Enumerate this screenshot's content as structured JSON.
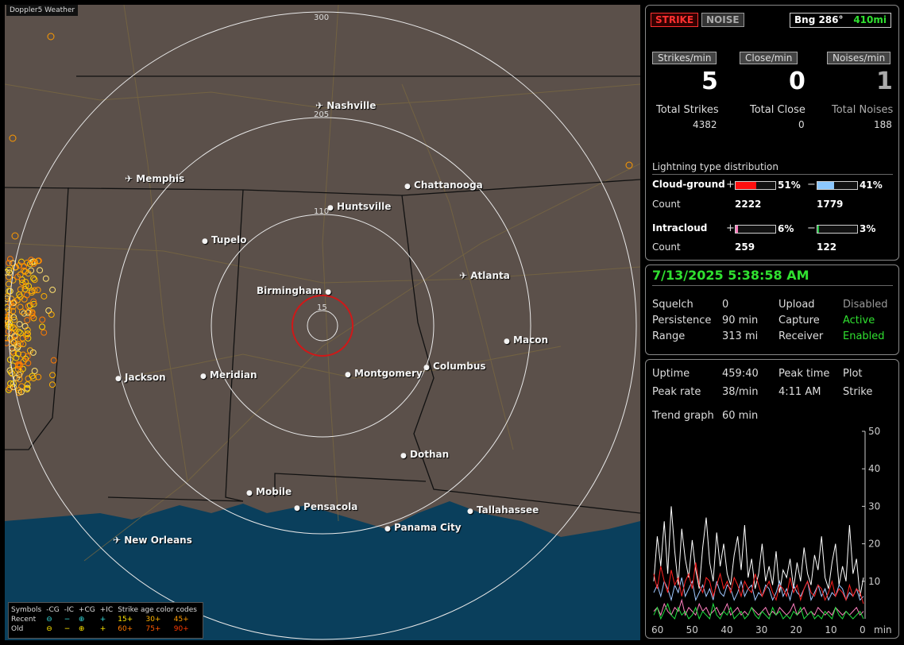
{
  "map": {
    "title": "Doppler5 Weather",
    "ring_labels": [
      "300",
      "205",
      "110",
      "15"
    ],
    "cities": [
      {
        "name": "Nashville",
        "icon": "airport-icon"
      },
      {
        "name": "Memphis",
        "icon": "airport-icon"
      },
      {
        "name": "Chattanooga",
        "icon": "city-dot-icon"
      },
      {
        "name": "Huntsville",
        "icon": "city-dot-icon"
      },
      {
        "name": "Tupelo",
        "icon": "city-dot-icon"
      },
      {
        "name": "Atlanta",
        "icon": "airport-icon"
      },
      {
        "name": "Birmingham",
        "icon": "city-dot-icon"
      },
      {
        "name": "Macon",
        "icon": "city-dot-icon"
      },
      {
        "name": "Jackson",
        "icon": "city-dot-icon"
      },
      {
        "name": "Meridian",
        "icon": "city-dot-icon"
      },
      {
        "name": "Montgomery",
        "icon": "city-dot-icon"
      },
      {
        "name": "Columbus",
        "icon": "city-dot-icon"
      },
      {
        "name": "Dothan",
        "icon": "city-dot-icon"
      },
      {
        "name": "Mobile",
        "icon": "city-dot-icon"
      },
      {
        "name": "Pensacola",
        "icon": "city-dot-icon"
      },
      {
        "name": "Tallahassee",
        "icon": "city-dot-icon"
      },
      {
        "name": "Panama City",
        "icon": "city-dot-icon"
      },
      {
        "name": "New Orleans",
        "icon": "airport-icon"
      }
    ],
    "legend": {
      "symbols": "Symbols",
      "cg_neg": "-CG",
      "ic_neg": "-IC",
      "cg_pos": "+CG",
      "ic_pos": "+IC",
      "age_title": "Strike age color codes",
      "recent": "Recent",
      "old": "Old",
      "recent_ages": [
        "15+",
        "30+",
        "45+"
      ],
      "old_ages": [
        "60+",
        "75+",
        "90+"
      ]
    }
  },
  "status": {
    "strike_button": "STRIKE",
    "noise_button": "NOISE",
    "bearing_label": "Bng 286°",
    "bearing_distance": "410mi",
    "strikes_per_min_label": "Strikes/min",
    "close_per_min_label": "Close/min",
    "noises_per_min_label": "Noises/min",
    "strikes_per_min": "5",
    "close_per_min": "0",
    "noises_per_min": "1",
    "total_strikes_label": "Total Strikes",
    "total_close_label": "Total Close",
    "total_noises_label": "Total Noises",
    "total_strikes": "4382",
    "total_close": "0",
    "total_noises": "188",
    "distribution_title": "Lightning type distribution",
    "cg_label": "Cloud-ground",
    "cg_pos_pct": "51%",
    "cg_neg_pct": "41%",
    "cg_pos_frac": 0.51,
    "cg_neg_frac": 0.41,
    "count_label": "Count",
    "cg_pos_count": "2222",
    "cg_neg_count": "1779",
    "ic_label": "Intracloud",
    "ic_pos_pct": "6%",
    "ic_neg_pct": "3%",
    "ic_pos_frac": 0.06,
    "ic_neg_frac": 0.03,
    "ic_pos_count": "259",
    "ic_neg_count": "122",
    "plus": "+",
    "minus": "−"
  },
  "settings": {
    "datetime": "7/13/2025 5:38:58 AM",
    "squelch_label": "Squelch",
    "squelch": "0",
    "persistence_label": "Persistence",
    "persistence": "90 min",
    "range_label": "Range",
    "range": "313 mi",
    "upload_label": "Upload",
    "upload": "Disabled",
    "capture_label": "Capture",
    "capture": "Active",
    "receiver_label": "Receiver",
    "receiver": "Enabled"
  },
  "trend": {
    "uptime_label": "Uptime",
    "uptime": "459:40",
    "peak_time_label": "Peak time",
    "plot_label": "Plot",
    "peak_rate_label": "Peak rate",
    "peak_rate": "38/min",
    "peak_time": "4:11 AM",
    "plot": "Strike",
    "trend_label": "Trend graph",
    "trend_window": "60 min",
    "y_ticks": [
      "50",
      "40",
      "30",
      "20",
      "10"
    ],
    "x_ticks": [
      "60",
      "50",
      "40",
      "30",
      "20",
      "10",
      "0"
    ],
    "x_unit": "min"
  },
  "chart_data": {
    "type": "line",
    "xlabel": "min",
    "ylim": [
      0,
      50
    ],
    "xlim": [
      60,
      0
    ],
    "series": [
      {
        "color": "#ffffff",
        "values": [
          10,
          22,
          14,
          26,
          12,
          30,
          18,
          9,
          24,
          16,
          11,
          21,
          13,
          8,
          19,
          27,
          15,
          10,
          23,
          14,
          20,
          12,
          9,
          17,
          22,
          13,
          25,
          11,
          16,
          8,
          12,
          20,
          10,
          14,
          9,
          18,
          7,
          13,
          11,
          16,
          8,
          15,
          10,
          19,
          12,
          9,
          17,
          13,
          22,
          11,
          8,
          15,
          20,
          9,
          14,
          10,
          25,
          12,
          16,
          6,
          11
        ]
      },
      {
        "color": "#a0c8ff",
        "values": [
          7,
          9,
          6,
          10,
          8,
          5,
          9,
          7,
          11,
          6,
          8,
          10,
          5,
          7,
          9,
          6,
          8,
          5,
          10,
          7,
          6,
          9,
          8,
          5,
          7,
          10,
          6,
          8,
          9,
          5,
          7,
          6,
          9,
          8,
          5,
          7,
          10,
          6,
          8,
          5,
          9,
          7,
          6,
          8,
          10,
          5,
          7,
          9,
          6,
          8,
          5,
          7,
          6,
          9,
          8,
          5,
          7,
          6,
          8,
          5,
          6
        ]
      },
      {
        "color": "#ff2020",
        "values": [
          12,
          8,
          14,
          10,
          7,
          13,
          9,
          11,
          6,
          10,
          12,
          8,
          15,
          9,
          7,
          11,
          10,
          6,
          9,
          12,
          8,
          10,
          7,
          11,
          9,
          6,
          10,
          8,
          7,
          12,
          9,
          6,
          8,
          10,
          7,
          5,
          9,
          8,
          6,
          11,
          7,
          9,
          5,
          8,
          10,
          7,
          6,
          9,
          8,
          5,
          7,
          10,
          6,
          8,
          7,
          5,
          9,
          6,
          8,
          7,
          4
        ]
      },
      {
        "color": "#ff80c0",
        "values": [
          2,
          3,
          1,
          4,
          2,
          1,
          3,
          2,
          5,
          1,
          3,
          2,
          1,
          4,
          2,
          3,
          1,
          2,
          3,
          1,
          2,
          4,
          1,
          2,
          3,
          1,
          2,
          1,
          3,
          2,
          1,
          2,
          3,
          1,
          2,
          1,
          3,
          2,
          1,
          2,
          4,
          1,
          2,
          3,
          1,
          2,
          1,
          3,
          2,
          1,
          2,
          1,
          3,
          2,
          1,
          2,
          1,
          2,
          3,
          1,
          2
        ]
      },
      {
        "color": "#20e040",
        "values": [
          1,
          3,
          0,
          2,
          4,
          1,
          0,
          3,
          1,
          2,
          0,
          1,
          3,
          0,
          2,
          1,
          0,
          4,
          1,
          0,
          2,
          1,
          3,
          0,
          1,
          2,
          0,
          1,
          3,
          1,
          0,
          2,
          1,
          0,
          3,
          1,
          2,
          0,
          1,
          0,
          2,
          1,
          3,
          0,
          1,
          2,
          0,
          1,
          0,
          2,
          1,
          0,
          3,
          1,
          0,
          2,
          1,
          0,
          1,
          2,
          0
        ]
      }
    ]
  }
}
